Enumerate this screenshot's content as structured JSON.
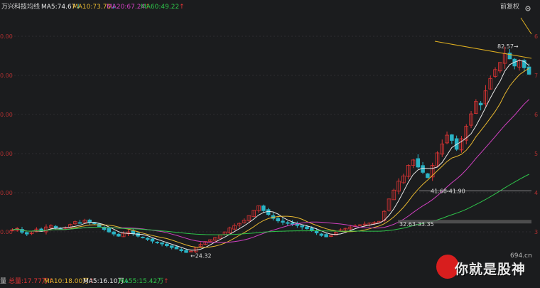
{
  "header": {
    "stock_name": "万兴科技",
    "indicator_label": "均线",
    "ma5": "MA5:74.67",
    "ma10": "MA10:73.70",
    "ma20": "MA20:67.24",
    "ma60": "MA60:49.22",
    "ma5_arrow": "↓",
    "ma10_arrow": "↓",
    "ma20_arrow": "↑",
    "ma60_arrow": "↑",
    "adjust_label": "前复权"
  },
  "footer": {
    "left_cut": "量",
    "total_volume": "总量:17.77万",
    "vol_ma10": "MA10:18.00万",
    "vol_ma5": "MA5:16.10万",
    "vol_ma55": "MA55:15.42万",
    "arrow_up": "↑",
    "arrow_down": "↓"
  },
  "colors": {
    "background": "#1b1c1e",
    "up": "#e03434",
    "down": "#2bb3c5",
    "ma5": "#e8e8e8",
    "ma10": "#e8b830",
    "ma20": "#d040c0",
    "ma60": "#2ec44a",
    "trendline": "#e0b020"
  },
  "chart_data": {
    "type": "candlestick",
    "y_ticks": [
      "0.00",
      "0.00",
      "0.00",
      "0.00",
      "0.00",
      "0.00"
    ],
    "right_edge_labels": [
      "6",
      "7",
      "6",
      "5",
      "4",
      "3"
    ],
    "annotations": [
      {
        "text": "82.57→",
        "price": 82.57
      },
      {
        "text": "41.68-41.90",
        "price": 41.79
      },
      {
        "text": "32.63-33.35",
        "price": 32.99
      },
      {
        "text": "←24.32",
        "price": 24.32
      }
    ],
    "price_range": [
      21,
      88
    ],
    "series_close": [
      30.8,
      31.2,
      30.1,
      29.6,
      30.4,
      31.0,
      30.5,
      31.6,
      32.0,
      31.2,
      30.9,
      31.4,
      32.3,
      33.1,
      32.7,
      33.5,
      32.8,
      32.5,
      31.6,
      30.9,
      30.2,
      29.6,
      29.0,
      29.8,
      30.2,
      29.7,
      29.0,
      28.6,
      28.1,
      27.6,
      27.2,
      26.8,
      26.3,
      25.8,
      25.4,
      24.9,
      24.4,
      24.8,
      25.9,
      26.7,
      27.5,
      28.0,
      28.6,
      29.4,
      30.2,
      31.3,
      32.0,
      32.6,
      33.5,
      34.8,
      36.3,
      37.6,
      36.2,
      35.1,
      34.0,
      33.3,
      32.9,
      32.6,
      32.3,
      32.0,
      31.6,
      31.1,
      30.6,
      29.9,
      29.2,
      28.8,
      29.3,
      30.1,
      30.8,
      31.2,
      31.6,
      31.9,
      32.2,
      32.4,
      32.7,
      32.9,
      33.2,
      36.0,
      39.5,
      42.0,
      44.5,
      46.0,
      49.0,
      50.5,
      48.5,
      47.0,
      45.5,
      49.0,
      52.5,
      55.0,
      57.5,
      56.0,
      53.5,
      56.5,
      60.0,
      63.5,
      67.0,
      66.0,
      70.0,
      73.5,
      76.0,
      78.0,
      80.5,
      79.0,
      77.0,
      78.5,
      76.5,
      74.67
    ],
    "ma_series": [
      {
        "name": "MA5",
        "final": 74.67
      },
      {
        "name": "MA10",
        "final": 73.7
      },
      {
        "name": "MA20",
        "final": 67.24
      },
      {
        "name": "MA60",
        "final": 49.22
      }
    ],
    "resistance_line_price": 41.79,
    "support_line_price": 32.99
  }
}
